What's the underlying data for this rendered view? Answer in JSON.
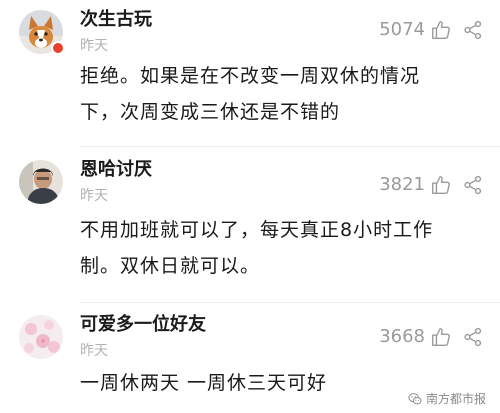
{
  "comments": [
    {
      "username": "次生古玩",
      "time": "昨天",
      "likes": "5074",
      "text_line1": "拒绝。如果是在不改变一周双休的情况",
      "text_line2": "下，次周变成三休还是不错的",
      "avatar_icon": "corgi-dog-avatar",
      "verified": true
    },
    {
      "username": "恩哈讨厌",
      "time": "昨天",
      "likes": "3821",
      "text_line1": "不用加班就可以了，每天真正8小时工作",
      "text_line2": "制。双休日就可以。",
      "avatar_icon": "person-photo-avatar",
      "verified": false
    },
    {
      "username": "可爱多一位好友",
      "time": "昨天",
      "likes": "3668",
      "text_line1": "一周休两天 一周休三天可好",
      "avatar_icon": "pink-blossom-avatar",
      "verified": false
    }
  ],
  "watermark": {
    "text": "南方都市报",
    "icon": "wechat-logo-icon"
  },
  "colors": {
    "name": "#1a1a1a",
    "meta": "#b3b3b3",
    "likes": "#9a9a9a",
    "badge": "#e8412f",
    "divider": "#ececec"
  }
}
